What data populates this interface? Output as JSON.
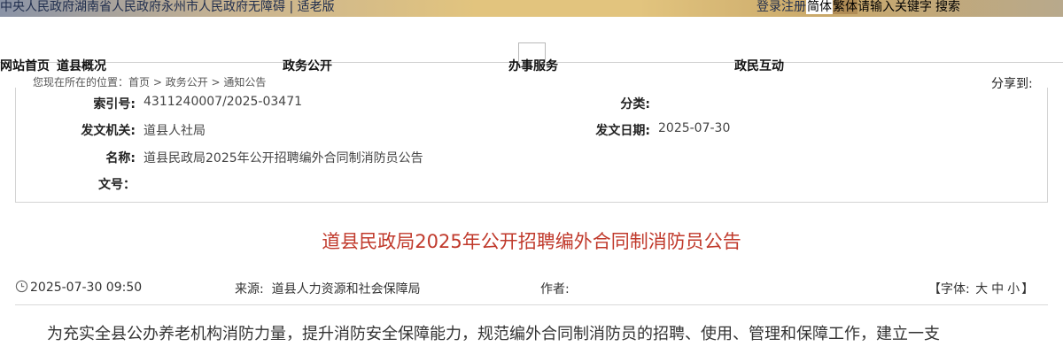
{
  "topbar": {
    "link_central": "中央人民政府",
    "link_province": "湖南省人民政府",
    "link_city": "永州市人民政府",
    "link_accessible": "无障碍",
    "separator": "|",
    "link_elder": "适老版",
    "login": "登录",
    "register": "注册",
    "simplified": "简体",
    "traditional": "繁体",
    "search_placeholder": "请输入关键字",
    "search_button": "搜索"
  },
  "nav": {
    "home": "网站首页",
    "overview": "道县概况",
    "gov_open": "政务公开",
    "service": "办事服务",
    "interaction": "政民互动"
  },
  "breadcrumb": {
    "prefix": "您现在所在的位置：",
    "home": "首页",
    "sep": " > ",
    "gov_open": "政务公开",
    "notice": "通知公告"
  },
  "share_label": "分享到:",
  "info": {
    "index_label": "索引号:",
    "index_value": "4311240007/2025-03471",
    "category_label": "分类:",
    "category_value": "",
    "issuer_label": "发文机关:",
    "issuer_value": "道县人社局",
    "date_label": "发文日期:",
    "date_value": "2025-07-30",
    "name_label": "名称:",
    "name_value": "道县民政局2025年公开招聘编外合同制消防员公告",
    "docno_label": "文号：",
    "docno_value": ""
  },
  "title": "道县民政局2025年公开招聘编外合同制消防员公告",
  "meta": {
    "datetime": "2025-07-30 09:50",
    "source_label": "来源:",
    "source_value": "道县人力资源和社会保障局",
    "author_label": "作者:",
    "author_value": "",
    "font_prefix": "【字体:",
    "font_large": "大",
    "font_medium": "中",
    "font_small": "小",
    "font_suffix": "】"
  },
  "body": "为充实全县公办养老机构消防力量，提升消防安全保障能力，规范编外合同制消防员的招聘、使用、管理和保障工作，建立一支",
  "colors": {
    "title_red": "#c0392b",
    "topbar_gold": "#e2c47e"
  },
  "icons": {
    "clock": "clock-icon"
  }
}
